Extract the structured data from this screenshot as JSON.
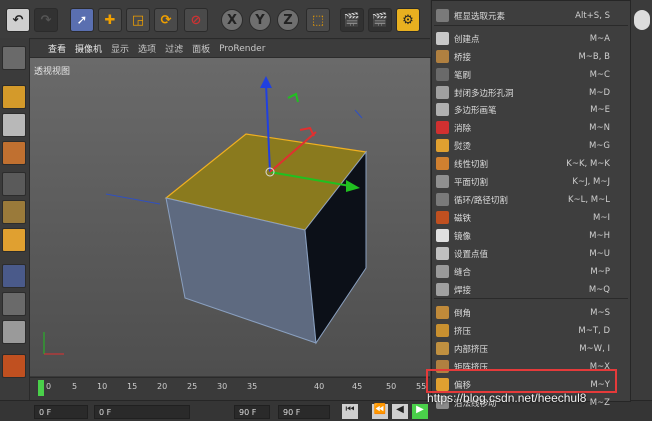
{
  "viewport": {
    "menu": [
      "查看",
      "摄像机",
      "显示",
      "选项",
      "过滤",
      "面板",
      "ProRender"
    ],
    "label": "透视视图"
  },
  "toolbar": {
    "axes": [
      "X",
      "Y",
      "Z"
    ]
  },
  "timeline": {
    "ticks": [
      "0",
      "5",
      "10",
      "15",
      "20",
      "25",
      "30",
      "35",
      "40",
      "45",
      "50",
      "55"
    ],
    "fields": [
      "0 F",
      "0 F",
      "90 F",
      "90 F"
    ]
  },
  "menu": {
    "items": [
      {
        "label": "框显选取元素",
        "shortcut": "Alt+S, S",
        "icon": "frame-selection-icon"
      },
      {
        "label": "创建点",
        "shortcut": "M~A",
        "icon": "create-point-icon"
      },
      {
        "label": "桥接",
        "shortcut": "M~B, B",
        "icon": "bridge-icon"
      },
      {
        "label": "笔刷",
        "shortcut": "M~C",
        "icon": "brush-icon"
      },
      {
        "label": "封闭多边形孔洞",
        "shortcut": "M~D",
        "icon": "close-polygon-hole-icon"
      },
      {
        "label": "多边形画笔",
        "shortcut": "M~E",
        "icon": "polygon-pen-icon"
      },
      {
        "label": "消除",
        "shortcut": "M~N",
        "icon": "dissolve-icon"
      },
      {
        "label": "熨烫",
        "shortcut": "M~G",
        "icon": "iron-icon"
      },
      {
        "label": "线性切割",
        "shortcut": "K~K, M~K",
        "icon": "line-cut-icon"
      },
      {
        "label": "平面切割",
        "shortcut": "K~J, M~J",
        "icon": "plane-cut-icon"
      },
      {
        "label": "循环/路径切割",
        "shortcut": "K~L, M~L",
        "icon": "loop-path-cut-icon"
      },
      {
        "label": "磁铁",
        "shortcut": "M~I",
        "icon": "magnet-icon"
      },
      {
        "label": "镜像",
        "shortcut": "M~H",
        "icon": "mirror-icon"
      },
      {
        "label": "设置点值",
        "shortcut": "M~U",
        "icon": "set-point-value-icon"
      },
      {
        "label": "缝合",
        "shortcut": "M~P",
        "icon": "stitch-icon"
      },
      {
        "label": "焊接",
        "shortcut": "M~Q",
        "icon": "weld-icon"
      },
      {
        "label": "倒角",
        "shortcut": "M~S",
        "icon": "bevel-icon"
      },
      {
        "label": "挤压",
        "shortcut": "M~T, D",
        "icon": "extrude-icon"
      },
      {
        "label": "内部挤压",
        "shortcut": "M~W, I",
        "icon": "extrude-inner-icon"
      },
      {
        "label": "矩阵挤压",
        "shortcut": "M~X",
        "icon": "matrix-extrude-icon"
      },
      {
        "label": "偏移",
        "shortcut": "M~Y",
        "icon": "smooth-shift-icon"
      },
      {
        "label": "沿法线移动",
        "shortcut": "M~Z",
        "icon": "normal-move-icon"
      }
    ]
  },
  "watermark": "https://blog.csdn.net/heechul8",
  "colors": {
    "accent_highlight": "#e53a3a",
    "selected_face": "#8a7a1e",
    "selected_edge": "#f0b020"
  }
}
